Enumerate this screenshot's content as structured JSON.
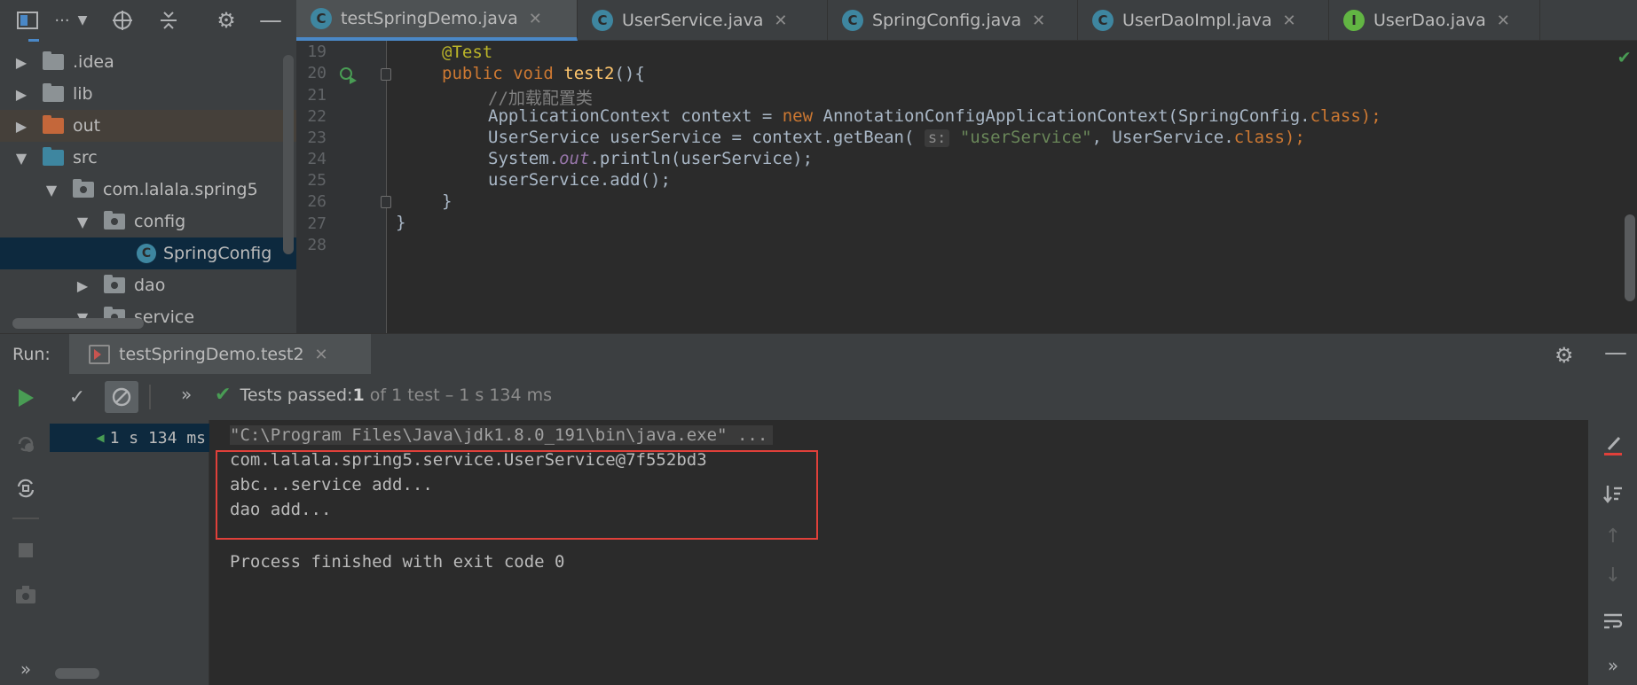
{
  "project": {
    "toolbar": {
      "view_label": "···",
      "icons": [
        "project-view-icon",
        "chevron-down-icon",
        "locate-icon",
        "collapse-icon",
        "gear-icon",
        "minimize-icon"
      ]
    },
    "tree": [
      {
        "label": ".idea",
        "expanded": false,
        "kind": "folder"
      },
      {
        "label": "lib",
        "expanded": false,
        "kind": "folder"
      },
      {
        "label": "out",
        "expanded": false,
        "kind": "excluded-folder"
      },
      {
        "label": "src",
        "expanded": true,
        "kind": "source-folder"
      },
      {
        "label": "com.lalala.spring5",
        "expanded": true,
        "kind": "package"
      },
      {
        "label": "config",
        "expanded": true,
        "kind": "package"
      },
      {
        "label": "SpringConfig",
        "kind": "class",
        "selected": true
      },
      {
        "label": "dao",
        "expanded": false,
        "kind": "package"
      },
      {
        "label": "service",
        "expanded": true,
        "kind": "package"
      }
    ]
  },
  "editor": {
    "tabs": [
      {
        "label": "testSpringDemo.java",
        "icon": "C",
        "active": true
      },
      {
        "label": "UserService.java",
        "icon": "C"
      },
      {
        "label": "SpringConfig.java",
        "icon": "C"
      },
      {
        "label": "UserDaoImpl.java",
        "icon": "C"
      },
      {
        "label": "UserDao.java",
        "icon": "I"
      }
    ],
    "line_numbers": [
      "19",
      "20",
      "21",
      "22",
      "23",
      "24",
      "25",
      "26",
      "27",
      "28"
    ],
    "code": {
      "l19": "@Test",
      "l20_a": "public void ",
      "l20_b": "test2",
      "l20_c": "(){",
      "l21": "//加载配置类",
      "l22_a": "ApplicationContext context = ",
      "l22_b": "new ",
      "l22_c": "AnnotationConfigApplicationContext(SpringConfig.",
      "l22_d": "class",
      "l22_e": ");",
      "l23_a": "UserService userService = context.getBean( ",
      "l23_hint": "s:",
      "l23_b": " \"userService\"",
      "l23_c": ", UserService.",
      "l23_d": "class",
      "l23_e": ");",
      "l24_a": "System.",
      "l24_b": "out",
      "l24_c": ".println(userService);",
      "l25": "userService.add();",
      "l26": "}",
      "l27": "}"
    }
  },
  "run": {
    "label": "Run:",
    "tab_label": "testSpringDemo.test2",
    "status": {
      "prefix": "Tests passed: ",
      "count": "1",
      "suffix": " of 1 test – 1 s 134 ms"
    },
    "tree_item": "1 s 134 ms",
    "console": {
      "cmd": "\"C:\\Program Files\\Java\\jdk1.8.0_191\\bin\\java.exe\" ...",
      "out1": "com.lalala.spring5.service.UserService@7f552bd3",
      "out2": "abc...service add...",
      "out3": "dao add...",
      "exit": "Process finished with exit code 0"
    }
  },
  "colors": {
    "accent": "#4a88c7",
    "pass": "#499c54",
    "highlight_box": "#e0403a"
  }
}
